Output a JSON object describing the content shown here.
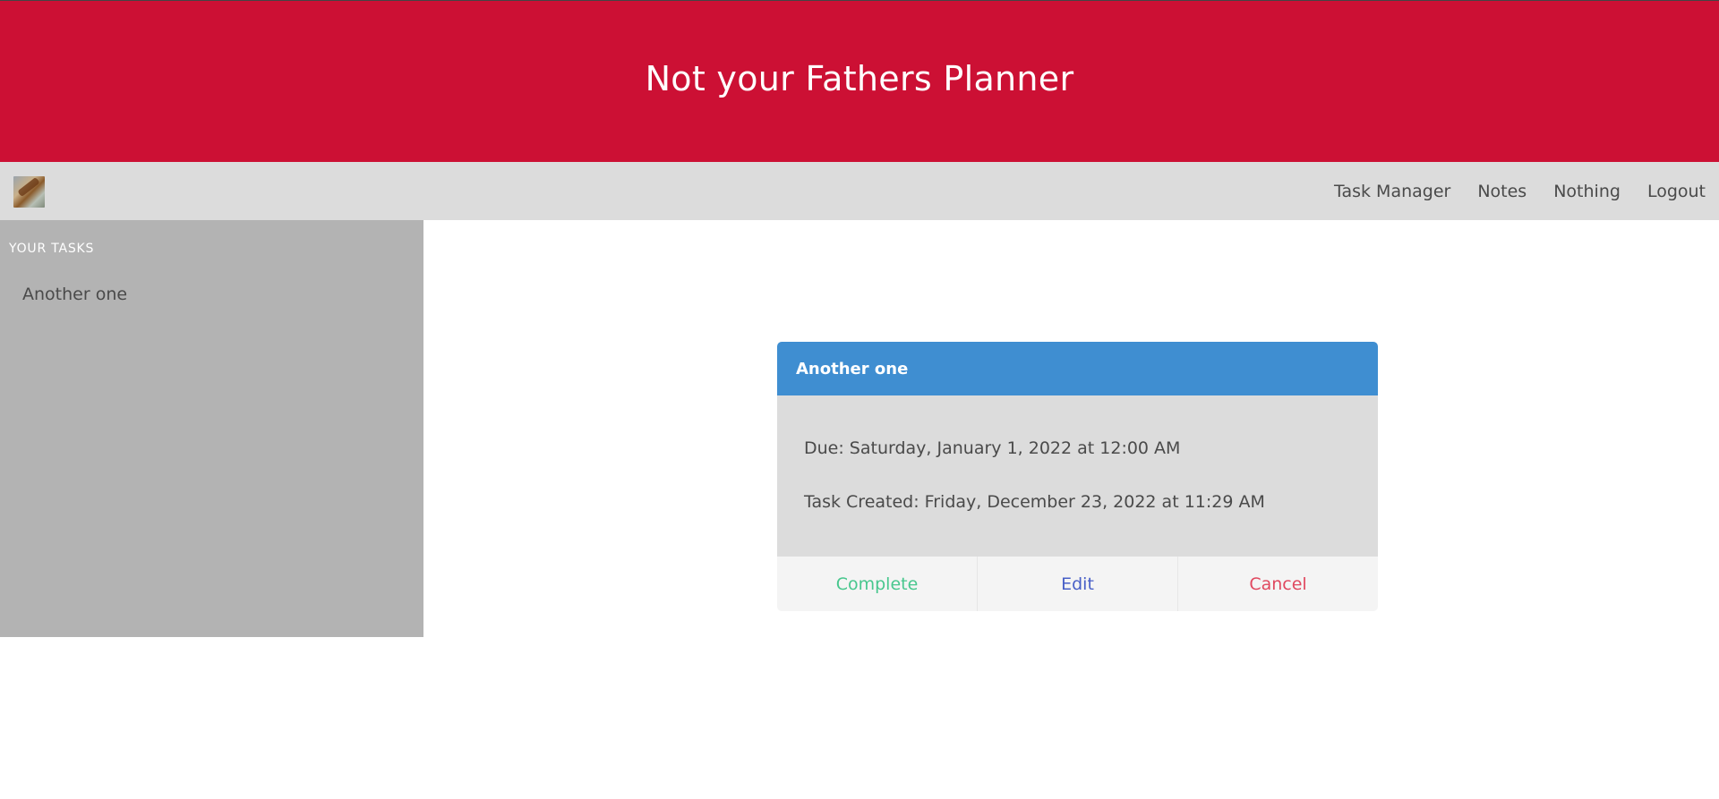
{
  "app": {
    "title": "Not your Fathers Planner"
  },
  "navbar": {
    "avatar_icon": "user-avatar-photo",
    "links": [
      {
        "label": "Task Manager"
      },
      {
        "label": "Notes"
      },
      {
        "label": "Nothing"
      },
      {
        "label": "Logout"
      }
    ]
  },
  "sidebar": {
    "heading": "YOUR TASKS",
    "items": [
      {
        "label": "Another one"
      }
    ]
  },
  "task_card": {
    "title": "Another one",
    "due": "Due: Saturday, January 1, 2022 at 12:00 AM",
    "created": "Task Created: Friday, December 23, 2022 at 11:29 AM",
    "actions": {
      "complete": "Complete",
      "edit": "Edit",
      "cancel": "Cancel"
    }
  },
  "colors": {
    "banner": "#cc1034",
    "navbar": "#dcdcdc",
    "sidebar": "#b3b3b3",
    "card_header": "#3f8ed1",
    "complete": "#48c78e",
    "edit": "#485fc7",
    "cancel": "#e0485f"
  }
}
